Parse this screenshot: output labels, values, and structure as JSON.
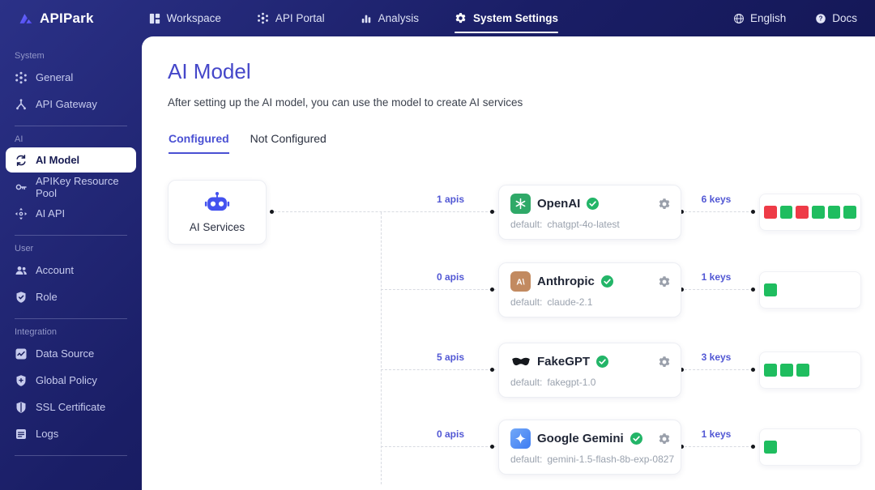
{
  "brand": {
    "name": "APIPark"
  },
  "topnav": {
    "items": [
      {
        "label": "Workspace"
      },
      {
        "label": "API Portal"
      },
      {
        "label": "Analysis"
      },
      {
        "label": "System Settings",
        "active": true
      }
    ],
    "utils": [
      {
        "label": "English"
      },
      {
        "label": "Docs"
      }
    ]
  },
  "sidebar": {
    "sections": [
      {
        "title": "System",
        "items": [
          {
            "label": "General"
          },
          {
            "label": "API Gateway"
          }
        ]
      },
      {
        "title": "AI",
        "items": [
          {
            "label": "AI Model",
            "active": true
          },
          {
            "label": "APIKey Resource Pool"
          },
          {
            "label": "AI API"
          }
        ]
      },
      {
        "title": "User",
        "items": [
          {
            "label": "Account"
          },
          {
            "label": "Role"
          }
        ]
      },
      {
        "title": "Integration",
        "items": [
          {
            "label": "Data Source"
          },
          {
            "label": "Global Policy"
          },
          {
            "label": "SSL Certificate"
          },
          {
            "label": "Logs"
          }
        ]
      }
    ]
  },
  "page": {
    "title": "AI Model",
    "description": "After setting up the AI model, you can use the model to create AI services",
    "tabs": [
      {
        "label": "Configured",
        "active": true
      },
      {
        "label": "Not Configured"
      }
    ]
  },
  "diagram": {
    "root": {
      "label": "AI Services"
    },
    "default_prefix": "default:",
    "providers": [
      {
        "name": "OpenAI",
        "default_model": "chatgpt-4o-latest",
        "apis": "1 apis",
        "keys": "6 keys",
        "key_states": [
          "error",
          "ok",
          "error",
          "ok",
          "ok",
          "ok"
        ]
      },
      {
        "name": "Anthropic",
        "default_model": "claude-2.1",
        "apis": "0 apis",
        "keys": "1 keys",
        "key_states": [
          "ok"
        ]
      },
      {
        "name": "FakeGPT",
        "default_model": "fakegpt-1.0",
        "apis": "5 apis",
        "keys": "3 keys",
        "key_states": [
          "ok",
          "ok",
          "ok"
        ]
      },
      {
        "name": "Google Gemini",
        "default_model": "gemini-1.5-flash-8b-exp-0827",
        "apis": "0 apis",
        "keys": "1 keys",
        "key_states": [
          "ok"
        ]
      }
    ],
    "colors": {
      "key_ok": "#1fbd5f",
      "key_error": "#ee3b47",
      "status_ok": "#23b568",
      "accent": "#4a50d3"
    }
  }
}
